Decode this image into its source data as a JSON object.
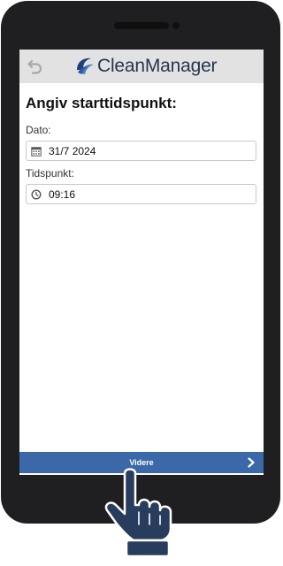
{
  "app": {
    "name": "CleanManager"
  },
  "page": {
    "title": "Angiv starttidspunkt:"
  },
  "form": {
    "date_label": "Dato:",
    "date_value": "31/7 2024",
    "time_label": "Tidspunkt:",
    "time_value": "09:16"
  },
  "footer": {
    "next_label": "Videre"
  },
  "colors": {
    "accent": "#3b68a9",
    "topbar": "#e2e2e3",
    "device": "#1f1f21",
    "hand": "#283c5e"
  },
  "icons": {
    "back": "undo-arrow-icon",
    "date": "calendar-icon",
    "time": "clock-icon",
    "next": "chevron-right-icon"
  }
}
